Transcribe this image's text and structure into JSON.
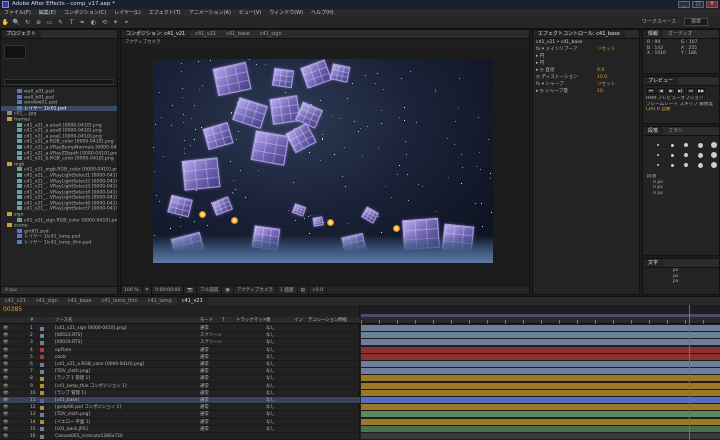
{
  "window": {
    "title": "Adobe After Effects - comp_v17.aep *",
    "controls": [
      "_",
      "□",
      "×"
    ]
  },
  "menu": [
    "ファイル(F)",
    "編集(E)",
    "コンポジション(C)",
    "レイヤー(L)",
    "エフェクト(T)",
    "アニメーション(A)",
    "ビュー(V)",
    "ウィンドウ(W)",
    "ヘルプ(H)"
  ],
  "toolbar": {
    "tools": [
      "✋",
      "🔍",
      "↻",
      "⊕",
      "▭",
      "✎",
      "T",
      "✒",
      "◐",
      "⟲",
      "✦",
      "⌖"
    ],
    "workspace_label": "ワークスペース :",
    "workspace_value": "標準"
  },
  "project": {
    "tab": "プロジェクト",
    "items": [
      {
        "name": "wall_a01.psd",
        "color": "#5a7ab8"
      },
      {
        "name": "wall_b01.psd",
        "color": "#5a7ab8"
      },
      {
        "name": "window01.psd",
        "color": "#5a7ab8"
      },
      {
        "name": "レイヤー 1/c01.psd",
        "color": "#5a7ab8"
      },
      {
        "name": "c01_...jpg",
        "color": "#8a8a8a"
      },
      {
        "name": "frames",
        "color": "#c8a040"
      },
      {
        "name": "c41_v21_a.aoaA [0000-0410].png",
        "color": "#6aa0a0"
      },
      {
        "name": "c41_v21_a.aoaB [0000-0410].png",
        "color": "#6aa0a0"
      },
      {
        "name": "c41_v21_a.aoaC [0000-0410].png",
        "color": "#6aa0a0"
      },
      {
        "name": "c41_v21_a.RGB_color [0000-0410].png",
        "color": "#6aa0a0"
      },
      {
        "name": "c41_v21_a.VRayBumpNormals [0000-0410].png",
        "color": "#6aa0a0"
      },
      {
        "name": "c41_v21_a.VRayZDepth [0000-0410].png",
        "color": "#6aa0a0"
      },
      {
        "name": "c41_v21_b.RGB_color [0000-0410].png",
        "color": "#6aa0a0"
      },
      {
        "name": "mgb",
        "color": "#c8a040"
      },
      {
        "name": "c41_v21_mgb.RGB_color [0000-0410].png",
        "color": "#6aa0a0"
      },
      {
        "name": "c41_v21_...VRayLightSelect1 [0000-0410].pn",
        "color": "#6aa0a0"
      },
      {
        "name": "c41_v21_...VRayLightSelect2 [0000-0410].pn",
        "color": "#6aa0a0"
      },
      {
        "name": "c41_v21_...VRayLightSelect3 [0000-0410].pn",
        "color": "#6aa0a0"
      },
      {
        "name": "c41_v21_...VRayLightSelect4 [0000-0410].pn",
        "color": "#6aa0a0"
      },
      {
        "name": "c41_v21_...VRayLightSelect5 [0000-0410].pn",
        "color": "#6aa0a0"
      },
      {
        "name": "c41_v21_...VRayLightSelect6 [0000-0410].pn",
        "color": "#6aa0a0"
      },
      {
        "name": "c41_v21_...VRayLightSelect7 [0000-0410].pn",
        "color": "#6aa0a0"
      },
      {
        "name": "sign",
        "color": "#c8a040"
      },
      {
        "name": "c41_v21_sign.RGB_color [0000-0410].png",
        "color": "#6aa0a0"
      },
      {
        "name": "scene",
        "color": "#c8a040"
      },
      {
        "name": "grid01.psd",
        "color": "#5a7ab8"
      },
      {
        "name": "レイヤー 1/c41_lamp.psd",
        "color": "#5a7ab8"
      },
      {
        "name": "レイヤー 1/c41_lamp_thin.psd",
        "color": "#5a7ab8"
      }
    ],
    "footer": "8 bpc"
  },
  "viewer": {
    "tabs": [
      "コンポジション: c41_v21",
      "c41_v21",
      "c41_base",
      "c41_sign"
    ],
    "label": "アクティブカメラ",
    "bar": [
      "100 %",
      "⌗",
      "0:00:00:00",
      "📷",
      "フル画質",
      "▣",
      "アクティブカメラ",
      "1 画面",
      "▤",
      "+0.0"
    ]
  },
  "effects": {
    "tab": "エフェクトコントロール: c41_base",
    "header": "c41_v21 • c41_base",
    "rows": [
      {
        "label": "fx ▾ メインリブーア",
        "value": "リセット"
      },
      {
        "label": "  ▸ 円",
        "value": ""
      },
      {
        "label": "  ▸ 円",
        "value": ""
      },
      {
        "label": "  ▸ ◷ 直径",
        "value": "0.0"
      },
      {
        "label": "  ◷ ディストーション",
        "value": "10.0"
      },
      {
        "label": "fx ▾ シャープ",
        "value": "リセット"
      },
      {
        "label": "  ▸ ◷ シャープ量",
        "value": "10"
      }
    ]
  },
  "info": {
    "tab": "情報",
    "tab2": "オーディオ",
    "lines": [
      "R : 94",
      "G : 107",
      "B : 142",
      "A : 255",
      "X : 1010",
      "Y : 186"
    ]
  },
  "preview": {
    "tab": "プレビュー",
    "lines": [
      "RAM プレビューオプション",
      "フレームレート  スキップ  解像度",
      "(30)     0     自動"
    ]
  },
  "paragraph": {
    "tab": "段落",
    "tab2": "ブラシ",
    "lines": [
      "段落",
      "0 px",
      "0 px",
      "0 px"
    ]
  },
  "character": {
    "tab": "文字",
    "lines": [
      "px",
      "px",
      "px"
    ]
  },
  "timeline": {
    "tabs": [
      "c41_v21",
      "c41_sign",
      "c41_base",
      "c41_lamp_thin",
      "c41_lamp",
      "c41_v21"
    ],
    "timecode": "00385",
    "columns": [
      "#",
      "ソース名",
      "モード",
      "T",
      "トラックマット",
      "親",
      "イン",
      "デュレーション",
      "伸縮"
    ],
    "layers": [
      {
        "num": "1",
        "name": "[c41_v21_sign [0000-0410].png]",
        "mode": "通常",
        "parent": "なし",
        "color": "#6e7f9a",
        "bar": "#6e7f9a"
      },
      {
        "num": "2",
        "name": "[00023.RTS]",
        "mode": "スクリーン",
        "parent": "なし",
        "color": "#6e7f9a",
        "bar": "#6e7f9a"
      },
      {
        "num": "3",
        "name": "[00029.RTS]",
        "mode": "スクリーン",
        "parent": "なし",
        "color": "#6e7f9a",
        "bar": "#6e7f9a"
      },
      {
        "num": "4",
        "name": "opFlare",
        "mode": "通常",
        "parent": "なし",
        "color": "#a83a3a",
        "bar": "#8a3030"
      },
      {
        "num": "5",
        "name": "cools",
        "mode": "通常",
        "parent": "なし",
        "color": "#a83a3a",
        "bar": "#8a3030"
      },
      {
        "num": "6",
        "name": "[c41_v21_a.RGB_color [0000-0410].png]",
        "mode": "通常",
        "parent": "なし",
        "color": "#6e7f9a",
        "bar": "#6e7f9a"
      },
      {
        "num": "7",
        "name": "[TDV_cloth.png]",
        "mode": "通常",
        "parent": "なし",
        "color": "#6e7f9a",
        "bar": "#6e7f9a"
      },
      {
        "num": "8",
        "name": "[ランプ 1 管理 1]",
        "mode": "通常",
        "parent": "なし",
        "color": "#b09030",
        "bar": "#9a7a28"
      },
      {
        "num": "9",
        "name": "[c41_lamp_thin コンポジション 1]",
        "mode": "通常",
        "parent": "なし",
        "color": "#b09030",
        "bar": "#9a7a28"
      },
      {
        "num": "10",
        "name": "[ランプ 管理 1]",
        "mode": "通常",
        "parent": "なし",
        "color": "#b09030",
        "bar": "#9a7a28"
      },
      {
        "num": "11",
        "name": "[c41_base]",
        "mode": "通常",
        "parent": "なし",
        "color": "#4a6ab0",
        "bar": "#5a6cc0"
      },
      {
        "num": "12",
        "name": "[gridp00.psd コンポジション 1]",
        "mode": "通常",
        "parent": "なし",
        "color": "#b09030",
        "bar": "#9a7a28"
      },
      {
        "num": "13",
        "name": "[TDV_cloth.png]",
        "mode": "通常",
        "parent": "なし",
        "color": "#6e7f9a",
        "bar": "#5a8a60"
      },
      {
        "num": "14",
        "name": "[イエロー 平面 1]",
        "mode": "通常",
        "parent": "なし",
        "color": "#b09030",
        "bar": "#9a7a28"
      },
      {
        "num": "15",
        "name": "[c01_back.JPG]",
        "mode": "通常",
        "parent": "なし",
        "color": "#6e7f9a",
        "bar": "#4a7050"
      },
      {
        "num": "16",
        "name": "Canvas001_ccrecuto1280x720",
        "mode": "",
        "parent": "",
        "color": "#6e7f9a",
        "bar": "#3a3a3a"
      }
    ]
  }
}
